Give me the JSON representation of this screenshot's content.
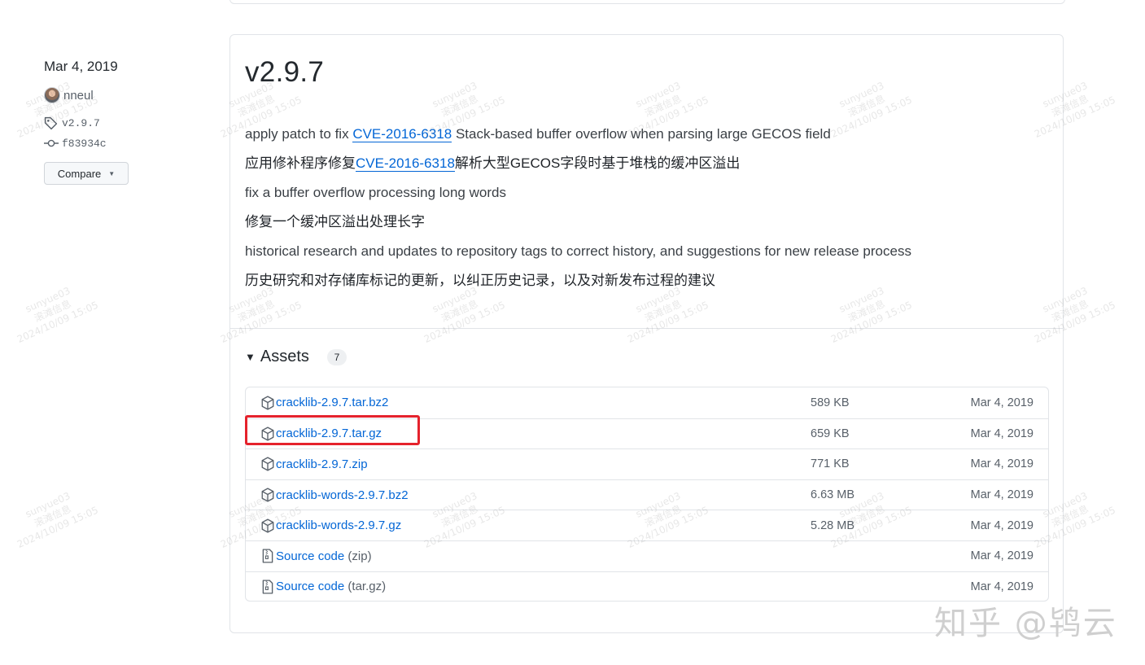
{
  "sidebar": {
    "date": "Mar 4, 2019",
    "author": "nneul",
    "tag": "v2.9.7",
    "commit": "f83934c",
    "compare_label": "Compare"
  },
  "release": {
    "title": "v2.9.7",
    "notes": [
      {
        "before": "apply patch to fix ",
        "link": "CVE-2016-6318",
        "after": " Stack-based buffer overflow when parsing large GECOS field"
      },
      {
        "before": "应用修补程序修复",
        "link": "CVE-2016-6318",
        "after": "解析大型GECOS字段时基于堆栈的缓冲区溢出"
      },
      {
        "before": "fix a buffer overflow processing long words",
        "link": "",
        "after": ""
      },
      {
        "before": "修复一个缓冲区溢出处理长字",
        "link": "",
        "after": ""
      },
      {
        "before": "historical research and updates to repository tags to correct history, and suggestions for new release process",
        "link": "",
        "after": ""
      },
      {
        "before": "历史研究和对存储库标记的更新，以纠正历史记录，以及对新发布过程的建议",
        "link": "",
        "after": ""
      }
    ]
  },
  "assets": {
    "title": "Assets",
    "count": "7",
    "items": [
      {
        "name": "cracklib-2.9.7.tar.bz2",
        "suffix": "",
        "size": "589 KB",
        "date": "Mar 4, 2019",
        "icon": "package-icon"
      },
      {
        "name": "cracklib-2.9.7.tar.gz",
        "suffix": "",
        "size": "659 KB",
        "date": "Mar 4, 2019",
        "icon": "package-icon"
      },
      {
        "name": "cracklib-2.9.7.zip",
        "suffix": "",
        "size": "771 KB",
        "date": "Mar 4, 2019",
        "icon": "package-icon"
      },
      {
        "name": "cracklib-words-2.9.7.bz2",
        "suffix": "",
        "size": "6.63 MB",
        "date": "Mar 4, 2019",
        "icon": "package-icon"
      },
      {
        "name": "cracklib-words-2.9.7.gz",
        "suffix": "",
        "size": "5.28 MB",
        "date": "Mar 4, 2019",
        "icon": "package-icon"
      },
      {
        "name": "Source code",
        "suffix": " (zip)",
        "size": "",
        "date": "Mar 4, 2019",
        "icon": "file-zip-icon"
      },
      {
        "name": "Source code",
        "suffix": " (tar.gz)",
        "size": "",
        "date": "Mar 4, 2019",
        "icon": "file-zip-icon"
      }
    ]
  },
  "overlay": {
    "zhihu_mark": "知乎 @鸨云",
    "watermark": [
      "sunyue03",
      "滚滩信息",
      "2024/10/09 15:05"
    ],
    "highlight_color": "#e5222c"
  }
}
